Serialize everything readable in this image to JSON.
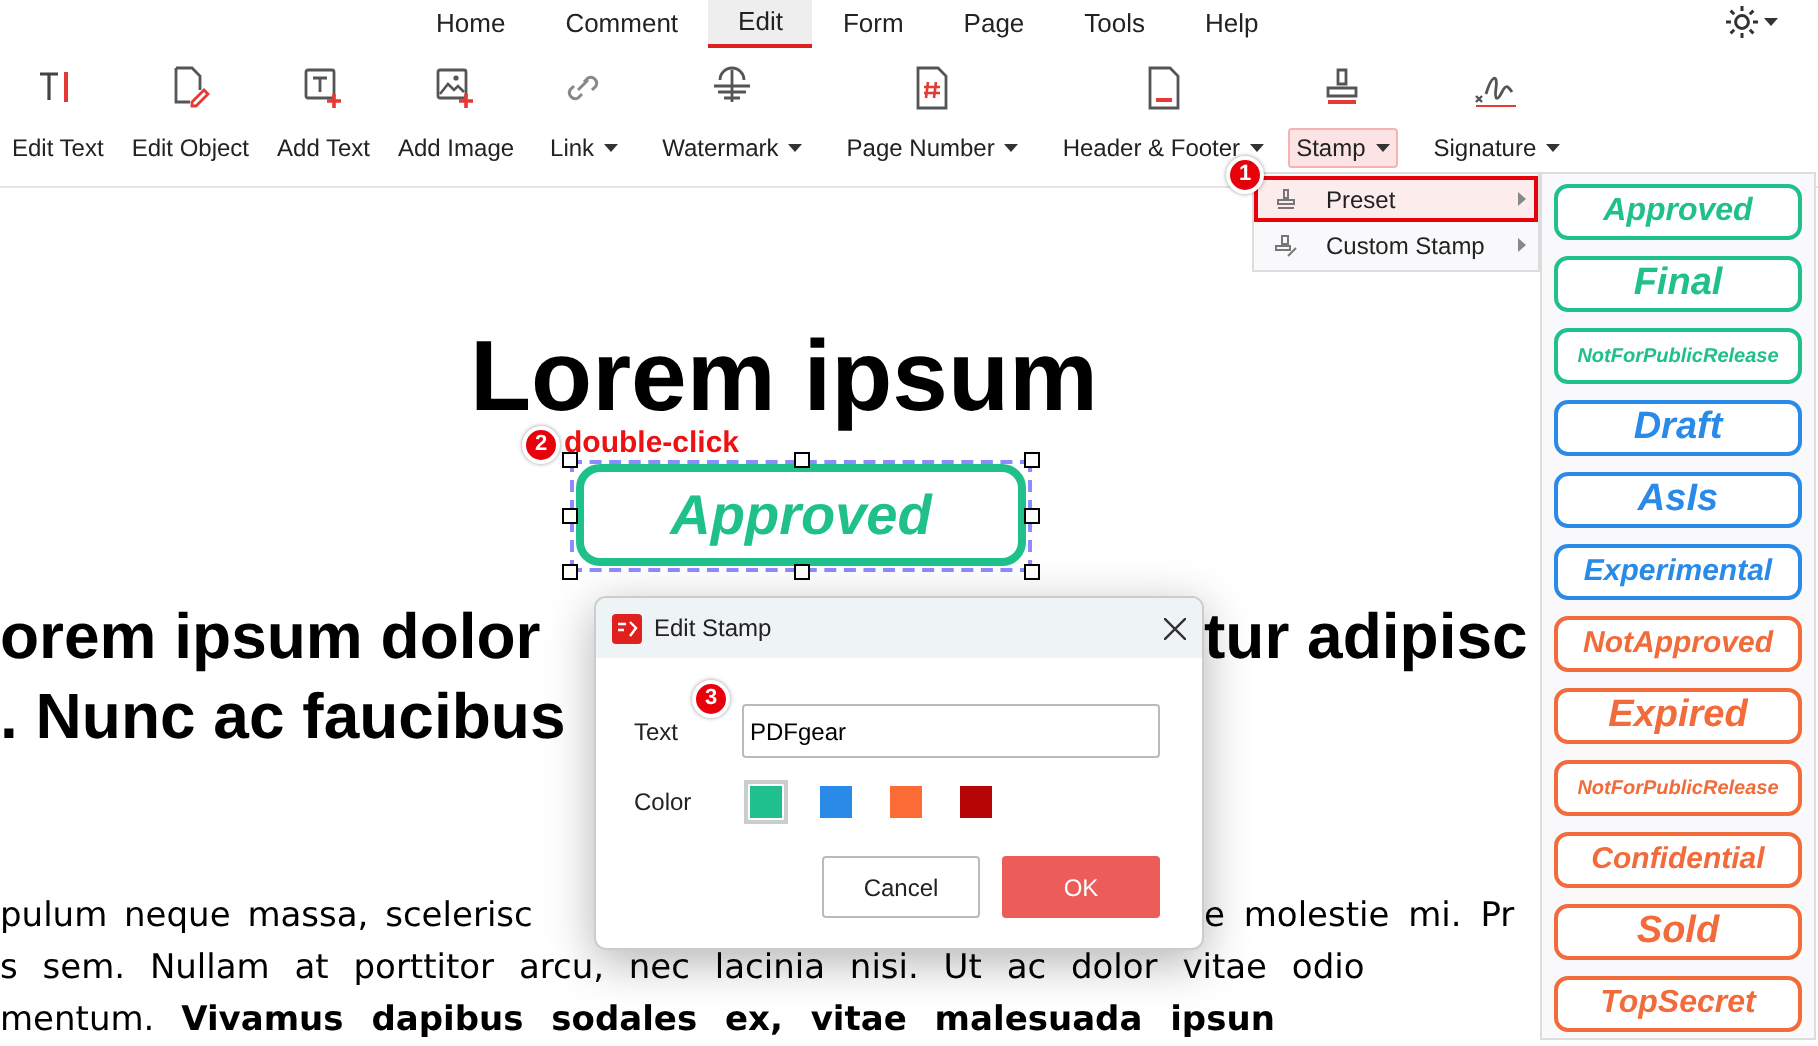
{
  "menu": [
    {
      "label": "Home",
      "selected": false
    },
    {
      "label": "Comment",
      "selected": false
    },
    {
      "label": "Edit",
      "selected": true
    },
    {
      "label": "Form",
      "selected": false
    },
    {
      "label": "Page",
      "selected": false
    },
    {
      "label": "Tools",
      "selected": false
    },
    {
      "label": "Help",
      "selected": false
    }
  ],
  "toolbar": [
    {
      "label": "Edit Text",
      "dropdown": false,
      "selected": false
    },
    {
      "label": "Edit Object",
      "dropdown": false,
      "selected": false
    },
    {
      "label": "Add Text",
      "dropdown": false,
      "selected": false
    },
    {
      "label": "Add Image",
      "dropdown": false,
      "selected": false
    },
    {
      "label": "Link",
      "dropdown": true,
      "selected": false
    },
    {
      "label": "Watermark",
      "dropdown": true,
      "selected": false
    },
    {
      "label": "Page Number",
      "dropdown": true,
      "selected": false
    },
    {
      "label": "Header & Footer",
      "dropdown": true,
      "selected": false
    },
    {
      "label": "Stamp",
      "dropdown": true,
      "selected": true
    },
    {
      "label": "Signature",
      "dropdown": true,
      "selected": false
    }
  ],
  "stamp_menu": [
    {
      "label": "Preset",
      "selected": true
    },
    {
      "label": "Custom Stamp",
      "selected": false
    }
  ],
  "stamp_list": [
    {
      "text": "Approved",
      "color": "#20c08c"
    },
    {
      "text": "Final",
      "color": "#20c08c"
    },
    {
      "text": "NotForPublicRelease",
      "color": "#20c08c"
    },
    {
      "text": "Draft",
      "color": "#2a8ae8"
    },
    {
      "text": "AsIs",
      "color": "#2a8ae8"
    },
    {
      "text": "Experimental",
      "color": "#2a8ae8"
    },
    {
      "text": "NotApproved",
      "color": "#f26b3a"
    },
    {
      "text": "Expired",
      "color": "#f26b3a"
    },
    {
      "text": "NotForPublicRelease",
      "color": "#f26b3a"
    },
    {
      "text": "Confidential",
      "color": "#f26b3a"
    },
    {
      "text": "Sold",
      "color": "#f26b3a"
    },
    {
      "text": "TopSecret",
      "color": "#f26b3a"
    }
  ],
  "document": {
    "title": "Lorem ipsum",
    "heading_lines": [
      {
        "left": "orem ipsum dolor",
        "right": "tur adipisc"
      },
      {
        "left": ". Nunc ac faucibus"
      }
    ],
    "paragraph_lines": [
      {
        "left": "pulum neque massa, scelerisc",
        "right": "e molestie mi. Pr"
      },
      {
        "left": "s sem. Nullam at porttitor arcu, nec lacinia nisi. Ut ac dolor vitae odio"
      },
      {
        "left": "mentum. **Vivamus dapibus sodales ex, vitae malesuada ipsun**"
      }
    ]
  },
  "placed_stamp": {
    "text": "Approved",
    "color": "#20c08c",
    "selected": true
  },
  "callouts": [
    {
      "number": "1"
    },
    {
      "number": "2",
      "label": "double-click"
    },
    {
      "number": "3"
    }
  ],
  "dialog": {
    "title": "Edit Stamp",
    "text_label": "Text",
    "text_value": "PDFgear",
    "color_label": "Color",
    "colors": [
      {
        "color": "#20c08c",
        "selected": true
      },
      {
        "color": "#2a8ae8",
        "selected": false
      },
      {
        "color": "#fb6b35",
        "selected": false
      },
      {
        "color": "#b50505",
        "selected": false
      }
    ],
    "buttons": [
      {
        "label": "Cancel",
        "kind": "secondary"
      },
      {
        "label": "OK",
        "kind": "primary"
      }
    ]
  }
}
